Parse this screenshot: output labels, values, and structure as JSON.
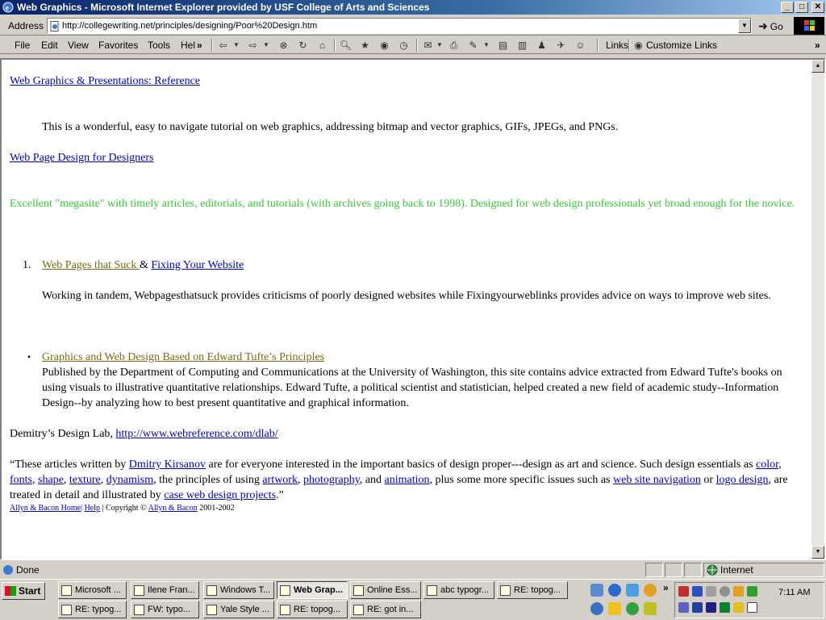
{
  "window": {
    "title": "Web Graphics - Microsoft Internet Explorer provided by USF College of Arts and Sciences",
    "min": "_",
    "max": "□",
    "close": "✕"
  },
  "address": {
    "label": "Address",
    "url": "http://collegewriting.net/principles/designing/Poor%20Design.htm",
    "go": "Go"
  },
  "menu": {
    "file": "File",
    "edit": "Edit",
    "view": "View",
    "favorites": "Favorites",
    "tools": "Tools",
    "help": "Hel",
    "links": "Links",
    "customize": "Customize Links",
    "more": "»"
  },
  "content": {
    "link1": "Web Graphics & Presentations: Reference",
    "desc1": "This is a wonderful, easy to navigate tutorial on web graphics, addressing bitmap and vector graphics, GIFs, JPEGs, and PNGs.",
    "link2": "Web Page Design for Designers",
    "desc2": "Excellent \"megasite\" with timely articles, editorials, and tutorials (with archives going back to 1998).  Designed for web design professionals yet broad enough for the novice.",
    "list_num": "1.",
    "link3a": "Web Pages that Suck ",
    "amp": "&",
    "link3b": "Fixing Your Website",
    "desc3": "Working in tandem, Webpagesthatsuck provides criticisms of poorly designed websites while Fixingyourweblinks  provides advice on ways to improve web sites.",
    "link4": "Graphics and Web Design Based on Edward Tufte’s Principles",
    "desc4": "Published by the Department of Computing and Communications at the University of Washington, this site contains advice extracted from Edward Tufte's books on using visuals to illustrative quantitative relationships.  Edward Tufte, a political scientist and statistician, helped created a new field of academic study--Information Design--by analyzing how to best present quantitative and graphical information.",
    "dlab_text": "Demitry’s Design Lab, ",
    "dlab_link": "http://www.webreference.com/dlab/",
    "quote": {
      "p1": "“These articles written by ",
      "kirsanov": "Dmitry Kirsanov",
      "p2": " are for everyone interested in the important basics of design proper---design as art and science. Such design essentials as ",
      "color": "color",
      "fonts": "fonts",
      "shape": "shape",
      "texture": "texture",
      "dynamism": "dynamism",
      "p3": ", the principles of using ",
      "artwork": "artwork",
      "photography": "photography",
      "and": ", and ",
      "animation": "animation",
      "p4": ", plus some more specific issues such as ",
      "navigation": "web site navigation",
      "or": " or ",
      "logo": "logo design",
      "p5": ", are treated in detail and illustrated by ",
      "projects": "case web design projects",
      "p6": ".”",
      "comma": ", "
    },
    "footer": {
      "home": "Allyn & Bacon Home",
      "sep1": "| ",
      "help": "Help",
      "copy": " | Copyright © ",
      "ab": "Allyn & Bacon",
      "years": " 2001-2002"
    }
  },
  "status": {
    "text": "Done",
    "zone": "Internet"
  },
  "taskbar": {
    "start": "Start",
    "row1": [
      "Microsoft ...",
      "Ilene Fran...",
      "Windows T...",
      "Web Grap...",
      "Online Ess...",
      "abc typogr...",
      "RE:  topog..."
    ],
    "row2": [
      "RE:  typog...",
      "FW:  typo...",
      "Yale Style ...",
      "RE:  topog...",
      "RE:  got in..."
    ],
    "clock": "7:11 AM"
  }
}
